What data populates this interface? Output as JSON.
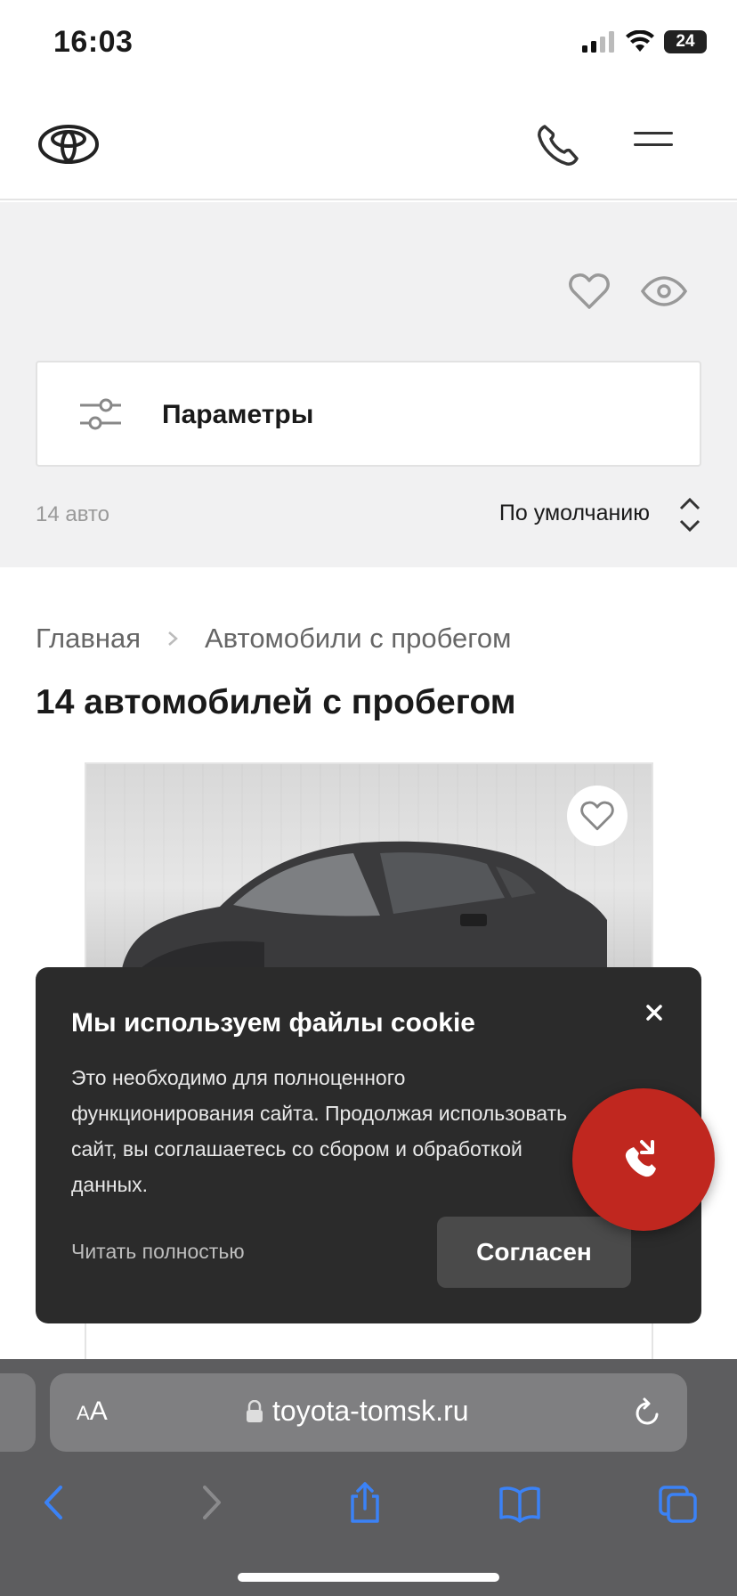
{
  "status_bar": {
    "time": "16:03",
    "battery": "24"
  },
  "header": {
    "logo": "toyota-logo",
    "phone_icon": "phone-icon",
    "menu_icon": "hamburger-menu-icon"
  },
  "filters": {
    "params_label": "Параметры",
    "count_label": "14 авто",
    "sort_label": "По умолчанию"
  },
  "breadcrumb": {
    "home": "Главная",
    "current": "Автомобили с пробегом"
  },
  "page_title": "14 автомобилей с пробегом",
  "cookie": {
    "title": "Мы используем файлы cookie",
    "text": "Это необходимо для полноценного функционирования сайта. Продолжая использовать сайт, вы соглашаетесь со сбором и обработкой данных.",
    "read_more": "Читать полностью",
    "accept": "Согласен"
  },
  "browser": {
    "aa_small": "A",
    "aa_large": "A",
    "url": "toyota-tomsk.ru"
  },
  "colors": {
    "accent_red": "#c0271f",
    "cookie_bg": "#2b2b2b",
    "page_grey": "#f1f1f2",
    "safari_blue": "#3b82f6"
  }
}
